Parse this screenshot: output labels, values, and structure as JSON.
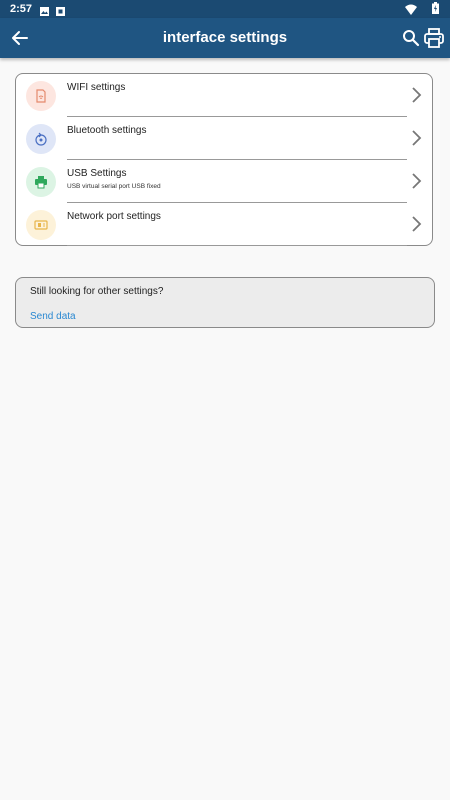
{
  "status_bar": {
    "time": "2:57",
    "icons": [
      "image-icon",
      "sim-card-icon",
      "wifi-icon",
      "battery-icon"
    ]
  },
  "app_bar": {
    "title": "interface settings",
    "back_icon": "back-arrow-icon",
    "actions": [
      "search-icon",
      "printer-icon"
    ]
  },
  "settings": {
    "items": [
      {
        "label": "WIFI settings",
        "icon": "wifi-file-icon",
        "icon_bg": "#fde6e0",
        "icon_color": "#e58a6d",
        "subtitle": ""
      },
      {
        "label": "Bluetooth settings",
        "icon": "bluetooth-rotate-icon",
        "icon_bg": "#dfe6f7",
        "icon_color": "#4a6fc2",
        "subtitle": ""
      },
      {
        "label": "USB Settings",
        "icon": "usb-printer-icon",
        "icon_bg": "#dcf4e4",
        "icon_color": "#2fa85c",
        "subtitle": "USB virtual serial port USB fixed"
      },
      {
        "label": "Network port settings",
        "icon": "network-port-icon",
        "icon_bg": "#fdf2d9",
        "icon_color": "#e8b54a",
        "subtitle": ""
      }
    ]
  },
  "notice": {
    "question": "Still looking for other settings?",
    "link": "Send data"
  },
  "colors": {
    "status_bar": "#1b4a72",
    "app_bar": "#1f5582",
    "link": "#2a88d1"
  }
}
